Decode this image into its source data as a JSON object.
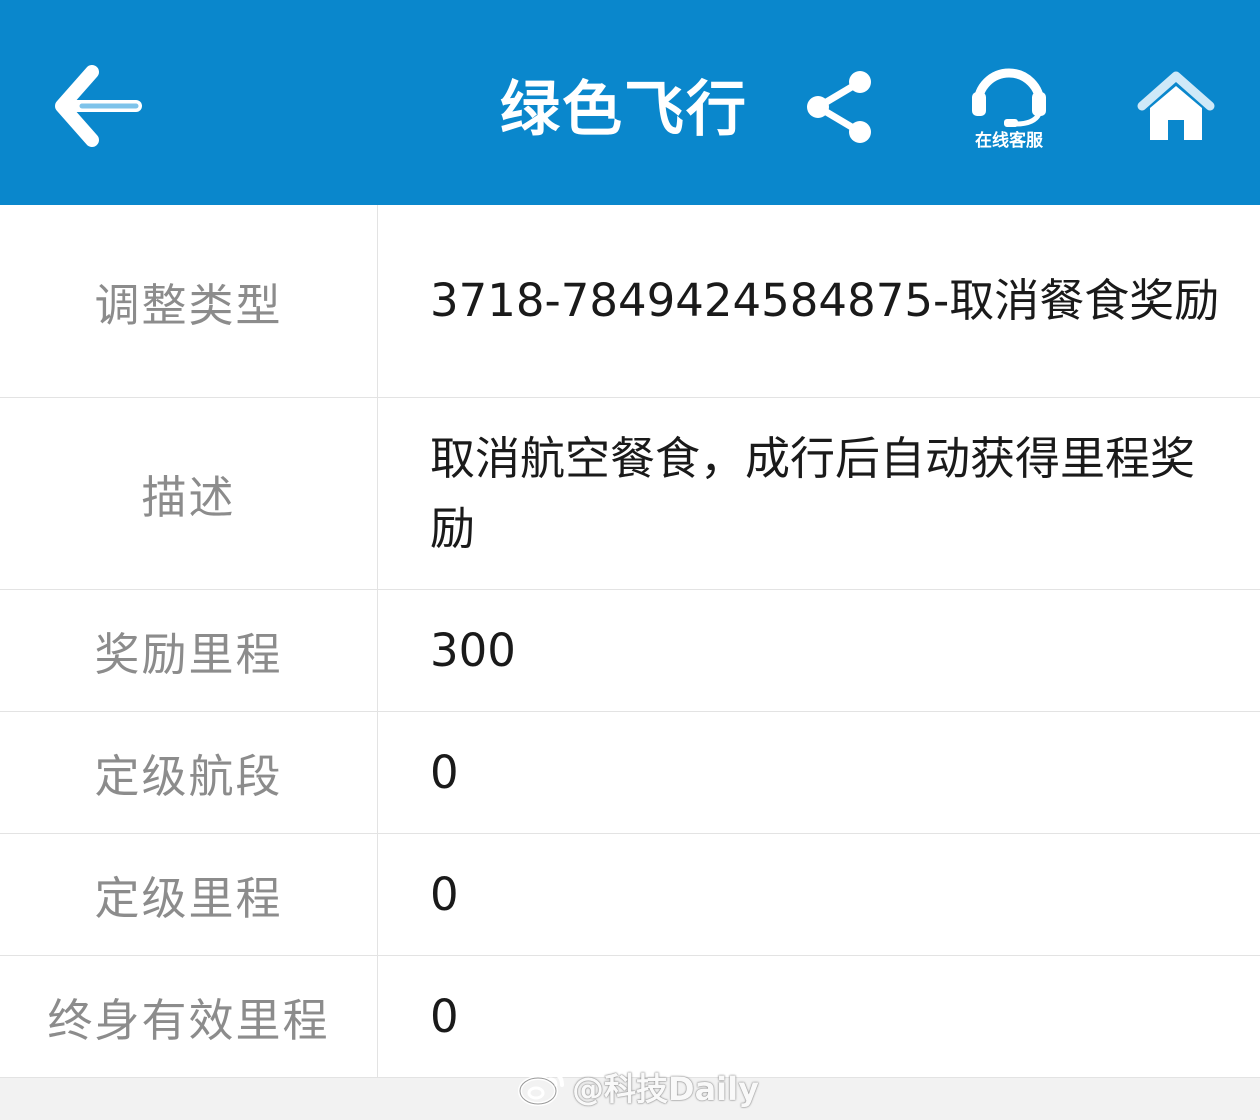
{
  "header": {
    "title": "绿色飞行",
    "customer_service_label": "在线客服",
    "background_color": "#0a87cc"
  },
  "icons": {
    "back": "back-arrow-icon",
    "share": "share-icon",
    "customer_service": "headset-icon",
    "home": "home-icon"
  },
  "rows": [
    {
      "label": "调整类型",
      "value": "3718-7849424584875-取消餐食奖励"
    },
    {
      "label": "描述",
      "value": "取消航空餐食，成行后自动获得里程奖励"
    },
    {
      "label": "奖励里程",
      "value": "300"
    },
    {
      "label": "定级航段",
      "value": "0"
    },
    {
      "label": "定级里程",
      "value": "0"
    },
    {
      "label": "终身有效里程",
      "value": "0"
    }
  ],
  "watermark": {
    "text": "@科技Daily"
  }
}
